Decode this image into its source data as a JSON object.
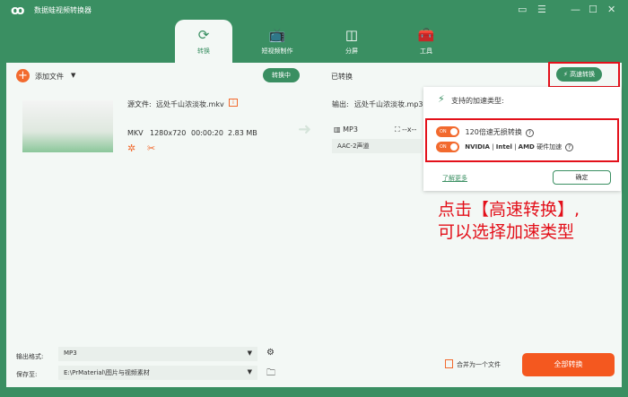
{
  "app": {
    "title": "数据蛙视频转换器"
  },
  "tabs": [
    {
      "label": "转换",
      "icon": "convert-icon"
    },
    {
      "label": "短视频制作",
      "icon": "tv-icon"
    },
    {
      "label": "分屏",
      "icon": "split-icon"
    },
    {
      "label": "工具",
      "icon": "toolbox-icon"
    }
  ],
  "toolbar": {
    "add_file": "添加文件",
    "converting": "转换中",
    "converted": "已转换",
    "high_speed": "高速转换"
  },
  "file": {
    "source_label": "源文件:",
    "source_name": "远处千山浓淡妆.mkv",
    "format": "MKV",
    "resolution": "1280x720",
    "duration": "00:00:20",
    "size": "2.83 MB",
    "output_label": "输出:",
    "output_name": "远处千山浓淡妆.mp3",
    "out_format": "MP3",
    "out_res": "--x--",
    "audio": "AAC-2声道"
  },
  "popup": {
    "title": "支持的加速类型:",
    "opt1": "120倍速无损转换",
    "opt2_nvidia": "NVIDIA",
    "opt2_intel": "Intel",
    "opt2_amd": "AMD",
    "opt2_suffix": "硬件加速",
    "toggle_on": "ON",
    "learn_more": "了解更多",
    "confirm": "确定"
  },
  "annotation": {
    "line1": "点击【高速转换】,",
    "line2": "可以选择加速类型"
  },
  "bottom": {
    "format_label": "输出格式:",
    "format_value": "MP3",
    "save_label": "保存至:",
    "save_path": "E:\\PrMaterial\\图片与视频素材",
    "merge": "合并为一个文件",
    "convert_all": "全部转换"
  },
  "colors": {
    "brand": "#3a8f62",
    "accent": "#f26a2e",
    "highlight": "#e3101a"
  }
}
